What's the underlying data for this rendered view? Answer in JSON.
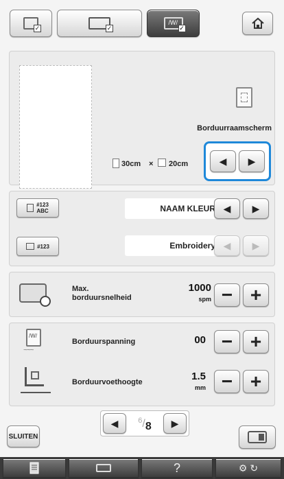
{
  "top_tabs": [
    {
      "icon": "book-settings-icon",
      "active": false
    },
    {
      "icon": "sewing-settings-icon",
      "active": false
    },
    {
      "icon": "embroidery-settings-icon",
      "active": true
    }
  ],
  "home_icon": "home-icon",
  "frame_display": {
    "label": "Borduurraamscherm",
    "width_value": "30cm",
    "times": "×",
    "height_value": "20cm"
  },
  "thread_display": {
    "color_name_value": "NAAM KLEUR",
    "brand_value": "Embroidery",
    "code_icon_top": "#123",
    "code_icon_top_sub": "ABC",
    "code_icon_bottom": "#123"
  },
  "max_speed": {
    "label_line1": "Max.",
    "label_line2": "borduursnelheid",
    "value": "1000",
    "unit": "spm"
  },
  "tension": {
    "label": "Borduurspanning",
    "value": "00"
  },
  "foot_height": {
    "label": "Borduurvoethoogte",
    "value": "1.5",
    "unit": "mm"
  },
  "pager": {
    "current": "6",
    "total": "8",
    "separator": "/"
  },
  "close_button": "SLUITEN",
  "footer": {
    "help": "?",
    "icons": [
      "document-icon",
      "machine-icon",
      "help-icon",
      "settings-refresh-icon"
    ]
  },
  "colors": {
    "highlight": "#1e88d9",
    "panel": "#ececec",
    "dark_button": "#3d3d3d"
  }
}
